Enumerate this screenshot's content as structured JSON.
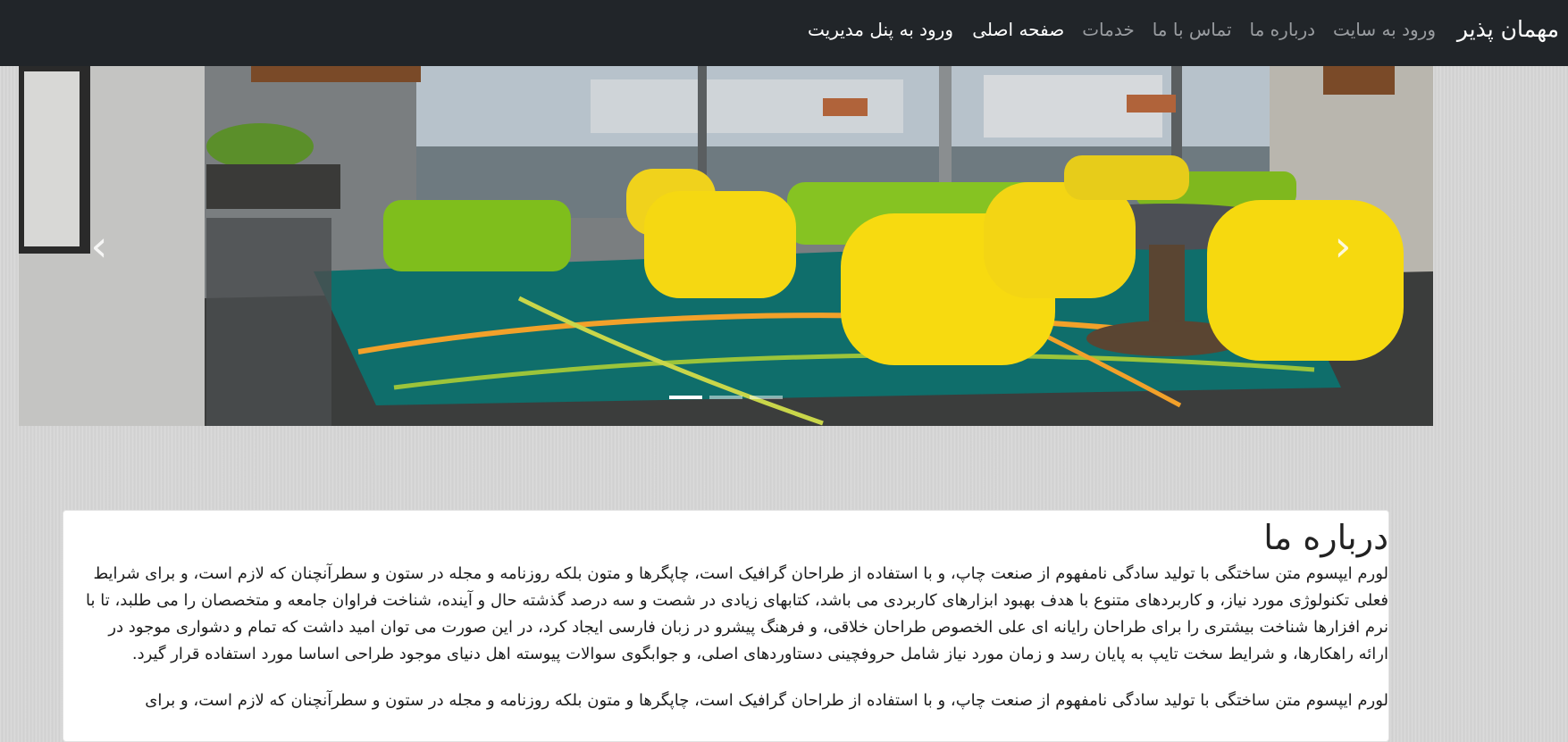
{
  "navbar": {
    "brand": "مهمان پذیر",
    "links": [
      {
        "label": "صفحه اصلی",
        "active": true
      },
      {
        "label": "خدمات",
        "active": false
      },
      {
        "label": "تماس با ما",
        "active": false
      },
      {
        "label": "درباره ما",
        "active": false
      },
      {
        "label": "ورود به سایت",
        "active": false
      }
    ],
    "admin_login": "ورود به پنل مدیریت"
  },
  "carousel": {
    "prev_icon": "‹",
    "next_icon": "›",
    "indicator_count": 3,
    "active_index": 0
  },
  "about": {
    "title": "درباره ما",
    "paragraph1": "لورم ایپسوم متن ساختگی با تولید سادگی نامفهوم از صنعت چاپ، و با استفاده از طراحان گرافیک است، چاپگرها و متون بلکه روزنامه و مجله در ستون و سطرآنچنان که لازم است، و برای شرایط فعلی تکنولوژی مورد نیاز، و کاربردهای متنوع با هدف بهبود ابزارهای کاربردی می باشد، کتابهای زیادی در شصت و سه درصد گذشته حال و آینده، شناخت فراوان جامعه و متخصصان را می طلبد، تا با نرم افزارها شناخت بیشتری را برای طراحان رایانه ای علی الخصوص طراحان خلاقی، و فرهنگ پیشرو در زبان فارسی ایجاد کرد، در این صورت می توان امید داشت که تمام و دشواری موجود در ارائه راهکارها، و شرایط سخت تایپ به پایان رسد و زمان مورد نیاز شامل حروفچینی دستاوردهای اصلی، و جوابگوی سوالات پیوسته اهل دنیای موجود طراحی اساسا مورد استفاده قرار گیرد.",
    "paragraph2": "لورم ایپسوم متن ساختگی با تولید سادگی نامفهوم از صنعت چاپ، و با استفاده از طراحان گرافیک است، چاپگرها و متون بلکه روزنامه و مجله در ستون و سطرآنچنان که لازم است، و برای"
  }
}
